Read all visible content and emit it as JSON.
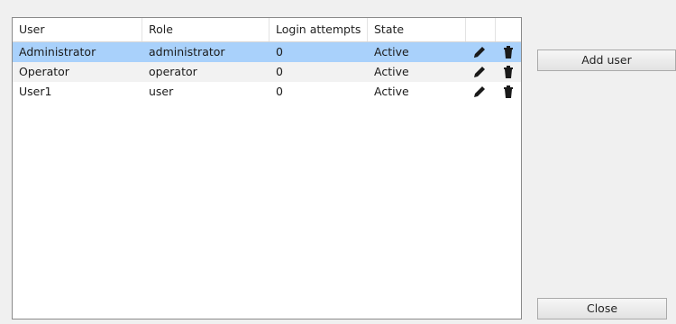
{
  "table": {
    "columns": [
      "User",
      "Role",
      "Login attempts",
      "State"
    ],
    "rows": [
      {
        "user": "Administrator",
        "role": "administrator",
        "attempts": "0",
        "state": "Active",
        "selected": true
      },
      {
        "user": "Operator",
        "role": "operator",
        "attempts": "0",
        "state": "Active"
      },
      {
        "user": "User1",
        "role": "user",
        "attempts": "0",
        "state": "Active"
      }
    ],
    "icons": {
      "edit": "pencil-icon",
      "delete": "trash-icon"
    }
  },
  "buttons": {
    "add_user": "Add user",
    "close": "Close"
  },
  "colors": {
    "selected_row": "#a9d1fb",
    "alt_row": "#f2f2f2"
  }
}
